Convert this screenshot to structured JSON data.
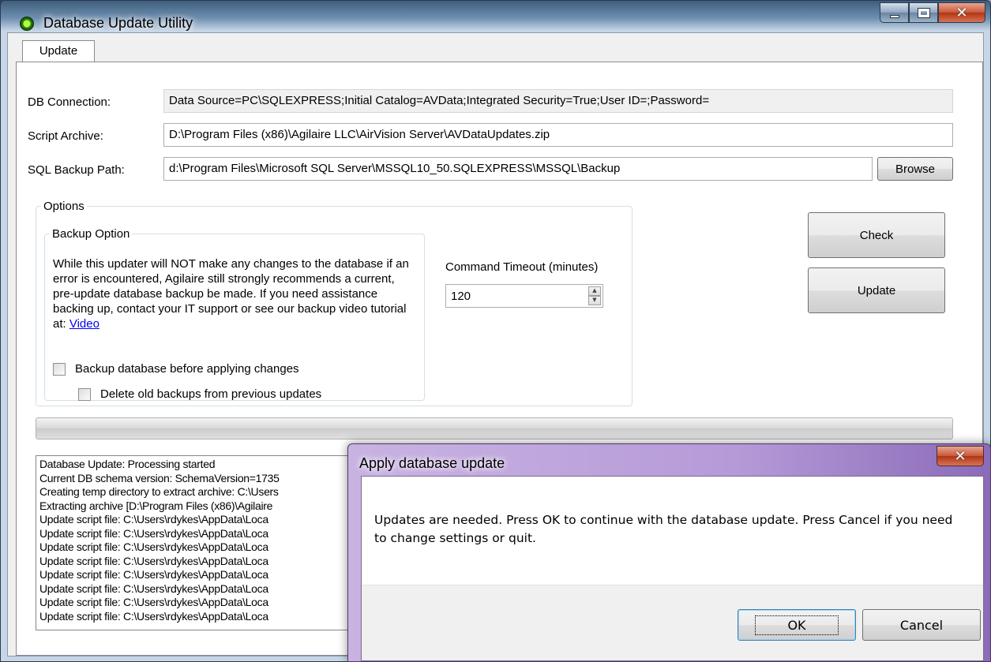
{
  "window": {
    "title": "Database Update Utility",
    "icon": "app-status-icon",
    "controls": {
      "minimize": "minimize-icon",
      "maximize": "maximize-icon",
      "close": "close-icon"
    }
  },
  "tabs": [
    {
      "label": "Update",
      "selected": true
    }
  ],
  "form": {
    "db_connection_label": "DB Connection:",
    "db_connection_value": "Data Source=PC\\SQLEXPRESS;Initial Catalog=AVData;Integrated Security=True;User ID=;Password=",
    "script_archive_label": "Script Archive:",
    "script_archive_value": "D:\\Program Files (x86)\\Agilaire LLC\\AirVision Server\\AVDataUpdates.zip",
    "sql_backup_label": "SQL Backup Path:",
    "sql_backup_value": "d:\\Program Files\\Microsoft SQL Server\\MSSQL10_50.SQLEXPRESS\\MSSQL\\Backup",
    "browse_label": "Browse"
  },
  "options": {
    "group_label": "Options",
    "backup_group_label": "Backup Option",
    "backup_text": "While this updater will NOT make any changes to the database if an error is encountered, Agilaire still strongly recommends a current, pre-update database backup be made. If you need assistance backing up, contact your IT support or see our backup video tutorial at: ",
    "video_link": "Video",
    "backup_checkbox_label": "Backup database before applying changes",
    "backup_checked": false,
    "delete_checkbox_label": "Delete old backups from previous updates",
    "delete_checked": false,
    "timeout_label": "Command Timeout (minutes)",
    "timeout_value": "120"
  },
  "actions": {
    "check_label": "Check",
    "update_label": "Update"
  },
  "progress": {
    "value": 0
  },
  "log": [
    "Database Update: Processing started",
    "Current DB schema version: SchemaVersion=1735",
    "Creating temp directory to extract archive: C:\\Users",
    "Extracting archive [D:\\Program Files (x86)\\Agilaire",
    "Update script file: C:\\Users\\rdykes\\AppData\\Loca",
    "Update script file: C:\\Users\\rdykes\\AppData\\Loca",
    "Update script file: C:\\Users\\rdykes\\AppData\\Loca",
    "Update script file: C:\\Users\\rdykes\\AppData\\Loca",
    "Update script file: C:\\Users\\rdykes\\AppData\\Loca",
    "Update script file: C:\\Users\\rdykes\\AppData\\Loca",
    "Update script file: C:\\Users\\rdykes\\AppData\\Loca",
    "Update script file: C:\\Users\\rdykes\\AppData\\Loca"
  ],
  "dialog": {
    "title": "Apply database update",
    "message": "Updates are needed.  Press OK to continue with the database update. Press Cancel if you need to change settings or quit.",
    "ok_label": "OK",
    "cancel_label": "Cancel"
  },
  "colors": {
    "link": "#0000ee",
    "progress_fill": "#06b025",
    "dialog_frame": "#b69ad8"
  }
}
